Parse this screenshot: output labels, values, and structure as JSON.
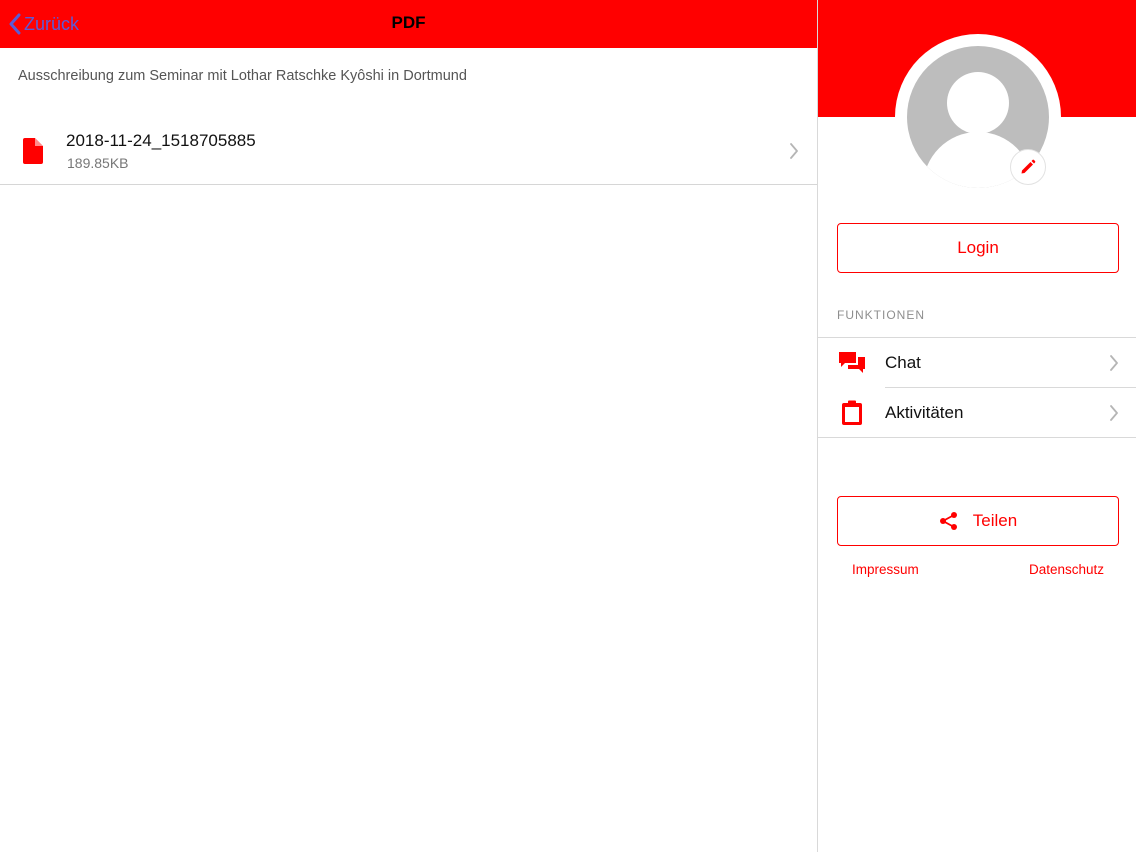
{
  "colors": {
    "accent": "#ff0000",
    "back_link": "#5b5bd6",
    "avatar_placeholder": "#bdbdbd"
  },
  "navbar": {
    "back_label": "Zurück",
    "title": "PDF"
  },
  "description": "Ausschreibung zum Seminar mit Lothar Ratschke Kyôshi in Dortmund",
  "files": [
    {
      "icon": "pdf-file-icon",
      "name": "2018-11-24_1518705885",
      "size": "189.85KB"
    }
  ],
  "sidebar": {
    "login_label": "Login",
    "section_title": "FUNKTIONEN",
    "menu": [
      {
        "icon": "chat-icon",
        "label": "Chat"
      },
      {
        "icon": "clipboard-icon",
        "label": "Aktivitäten"
      }
    ],
    "share_label": "Teilen",
    "footer_links": {
      "impressum": "Impressum",
      "datenschutz": "Datenschutz"
    }
  }
}
